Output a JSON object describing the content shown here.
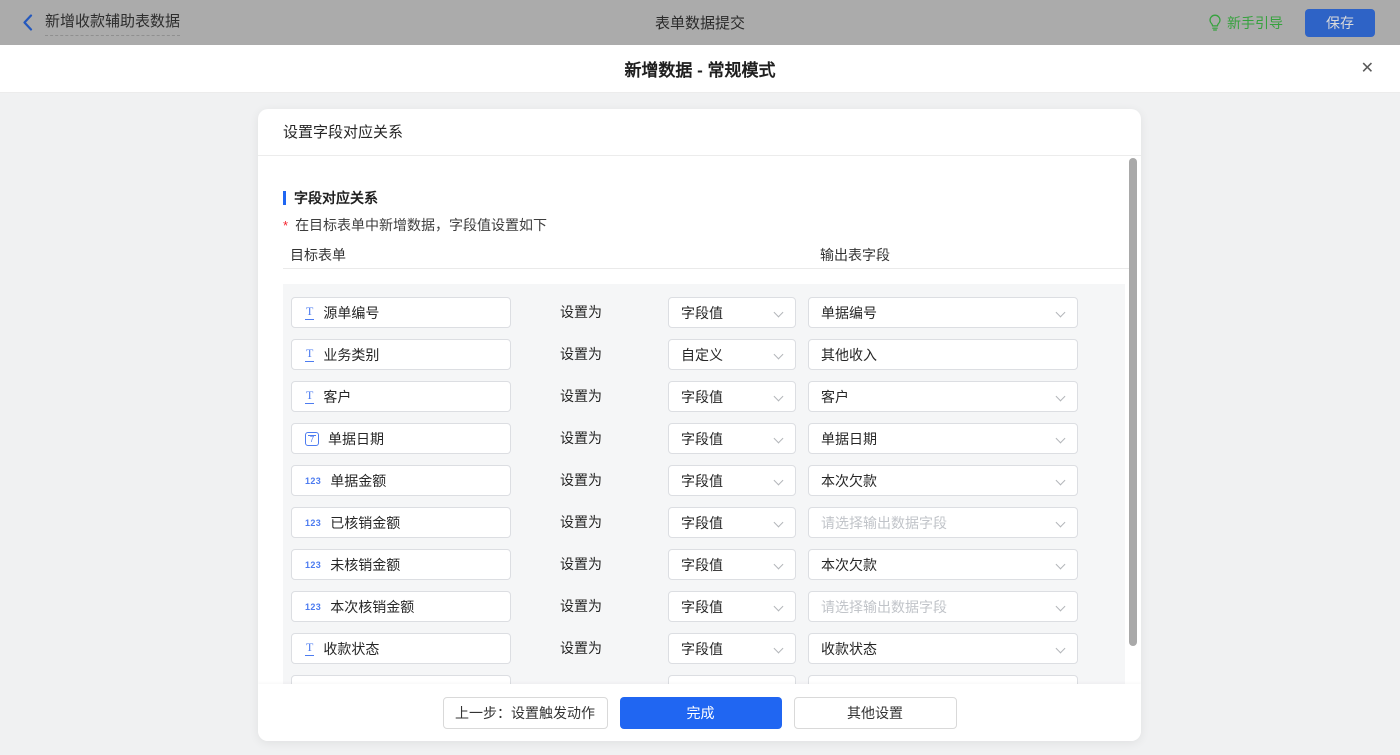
{
  "colors": {
    "accent": "#2066F2",
    "field_icon_blue": "#4D7CF0",
    "guide_green": "#36A23E"
  },
  "topbar": {
    "back_label": "新增收款辅助表数据",
    "title": "表单数据提交",
    "guide_label": "新手引导",
    "save_label": "保存"
  },
  "modal": {
    "title": "新增数据 - 常规模式",
    "close_label": "✕",
    "card_header": "设置字段对应关系",
    "section_title": "字段对应关系",
    "required_mark": "*",
    "section_note": "在目标表单中新增数据，字段值设置如下",
    "columns": {
      "left": "目标表单",
      "right": "输出表字段"
    },
    "set_as_label": "设置为",
    "icon_glyphs": {
      "text": "T",
      "number": "123",
      "date": "7"
    },
    "rows": [
      {
        "icon": "text",
        "field": "源单编号",
        "mode": "字段值",
        "output": "单据编号",
        "output_control": "select",
        "is_placeholder": false
      },
      {
        "icon": "text",
        "field": "业务类别",
        "mode": "自定义",
        "output": "其他收入",
        "output_control": "input",
        "is_placeholder": false
      },
      {
        "icon": "text",
        "field": "客户",
        "mode": "字段值",
        "output": "客户",
        "output_control": "select",
        "is_placeholder": false
      },
      {
        "icon": "date",
        "field": "单据日期",
        "mode": "字段值",
        "output": "单据日期",
        "output_control": "select",
        "is_placeholder": false
      },
      {
        "icon": "number",
        "field": "单据金额",
        "mode": "字段值",
        "output": "本次欠款",
        "output_control": "select",
        "is_placeholder": false
      },
      {
        "icon": "number",
        "field": "已核销金额",
        "mode": "字段值",
        "output": "请选择输出数据字段",
        "output_control": "select",
        "is_placeholder": true
      },
      {
        "icon": "number",
        "field": "未核销金额",
        "mode": "字段值",
        "output": "本次欠款",
        "output_control": "select",
        "is_placeholder": false
      },
      {
        "icon": "number",
        "field": "本次核销金额",
        "mode": "字段值",
        "output": "请选择输出数据字段",
        "output_control": "select",
        "is_placeholder": true
      },
      {
        "icon": "text",
        "field": "收款状态",
        "mode": "字段值",
        "output": "收款状态",
        "output_control": "select",
        "is_placeholder": false
      }
    ],
    "footer": {
      "prev": "上一步：设置触发动作",
      "done": "完成",
      "other": "其他设置"
    }
  }
}
